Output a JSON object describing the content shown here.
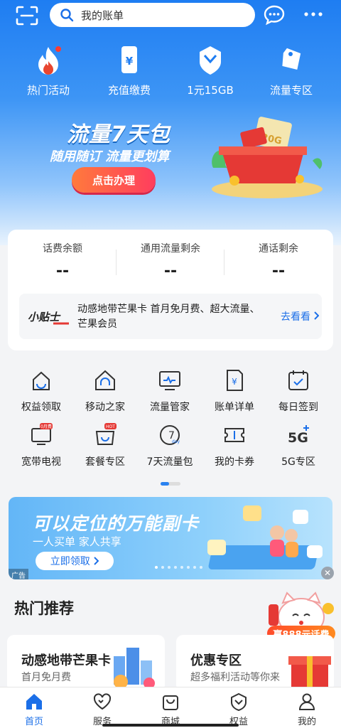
{
  "colors": {
    "brand": "#1e7df2",
    "accent": "#ff3d5e",
    "active_tab": "#1b6fe8"
  },
  "search": {
    "placeholder": "我的账单"
  },
  "quick_actions": [
    {
      "label": "热门活动",
      "icon": "flame-icon"
    },
    {
      "label": "充值缴费",
      "icon": "phone-yen-icon"
    },
    {
      "label": "1元15GB",
      "icon": "data-badge-icon"
    },
    {
      "label": "流量专区",
      "icon": "tag-icon"
    }
  ],
  "banner": {
    "title": "流量7天包",
    "subtitle": "随用随订 流量更划算",
    "button": "点击办理",
    "art_text": "20G"
  },
  "balance": [
    {
      "title": "话费余额",
      "value": "--"
    },
    {
      "title": "通用流量剩余",
      "value": "--"
    },
    {
      "title": "通话剩余",
      "value": "--"
    }
  ],
  "promo": {
    "logo": "小贴士",
    "text": "动感地带芒果卡 首月免月费、超大流量、芒果会员",
    "link": "去看看",
    "link_icon": "chevron-right-icon"
  },
  "services": [
    {
      "label": "权益领取",
      "icon": "gift-box-icon"
    },
    {
      "label": "移动之家",
      "icon": "home-headset-icon"
    },
    {
      "label": "流量管家",
      "icon": "monitor-chart-icon"
    },
    {
      "label": "账单详单",
      "icon": "bill-icon"
    },
    {
      "label": "每日签到",
      "icon": "calendar-check-icon"
    },
    {
      "label": "宽带电视",
      "icon": "tv-icon",
      "badge": "0月费"
    },
    {
      "label": "套餐专区",
      "icon": "shopping-bag-icon",
      "badge": "HOT"
    },
    {
      "label": "7天流量包",
      "icon": "seven-day-icon",
      "badge": "day"
    },
    {
      "label": "我的卡券",
      "icon": "coupon-icon"
    },
    {
      "label": "5G专区",
      "icon": "five-g-icon"
    }
  ],
  "ad": {
    "title": "可以定位的万能副卡",
    "subtitle": "一人买单 家人共享",
    "button": "立即领取",
    "tag": "广告",
    "close": "✕"
  },
  "hot": {
    "title": "热门推荐",
    "prize": "赢888元话费"
  },
  "hot_cards": [
    {
      "title": "动感地带芒果卡",
      "subtitle": "首月免月费"
    },
    {
      "title": "优惠专区",
      "subtitle": "超多福利活动等你来"
    }
  ],
  "tabs": [
    {
      "label": "首页",
      "icon": "home-icon",
      "active": true
    },
    {
      "label": "服务",
      "icon": "heart-icon",
      "active": false
    },
    {
      "label": "商城",
      "icon": "bag-icon",
      "active": false
    },
    {
      "label": "权益",
      "icon": "shield-badge-icon",
      "active": false
    },
    {
      "label": "我的",
      "icon": "user-icon",
      "active": false
    }
  ]
}
